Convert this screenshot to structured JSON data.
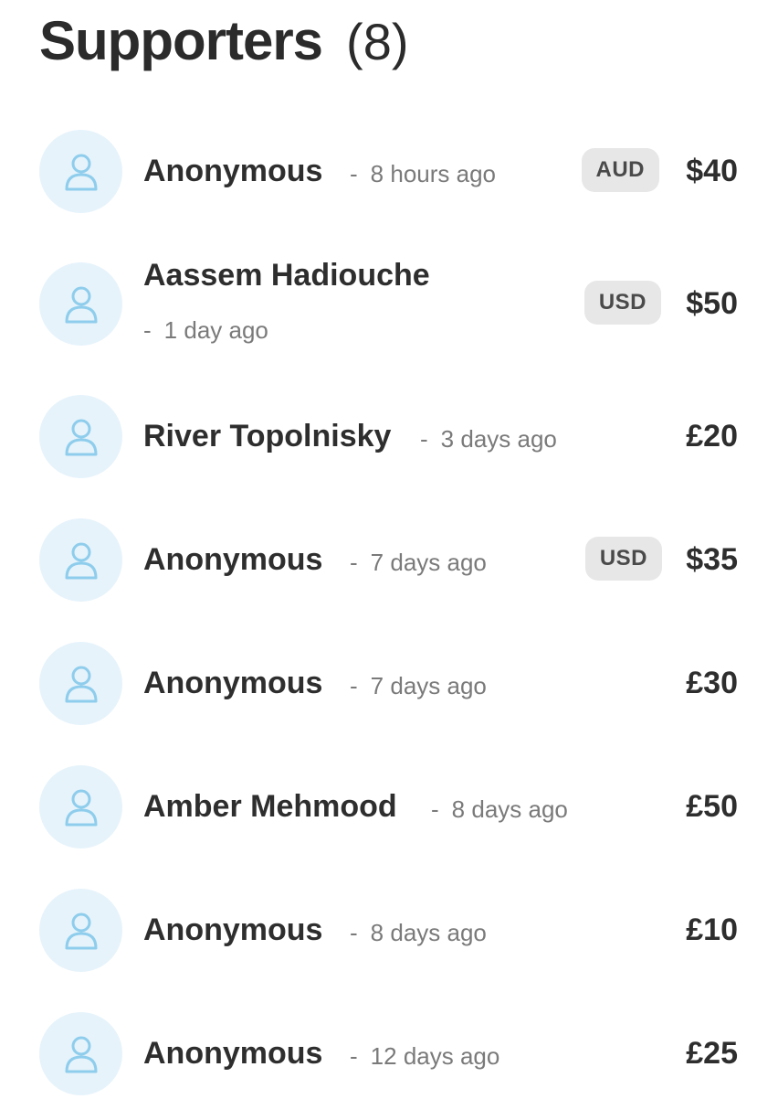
{
  "header": {
    "title": "Supporters",
    "count": "(8)"
  },
  "icons": {
    "avatar": "user-icon",
    "avatar_color": "#8fcdec",
    "avatar_bg": "#e6f3fb"
  },
  "supporters": [
    {
      "name": "Anonymous",
      "dash": "-",
      "time": "8 hours ago",
      "currency": "AUD",
      "amount": "$40"
    },
    {
      "name": "Aassem Hadiouche",
      "dash": "-",
      "time": "1 day ago",
      "currency": "USD",
      "amount": "$50"
    },
    {
      "name": "River Topolnisky",
      "dash": "-",
      "time": "3 days ago",
      "currency": "",
      "amount": "£20"
    },
    {
      "name": "Anonymous",
      "dash": "-",
      "time": "7 days ago",
      "currency": "USD",
      "amount": "$35"
    },
    {
      "name": "Anonymous",
      "dash": "-",
      "time": "7 days ago",
      "currency": "",
      "amount": "£30"
    },
    {
      "name": "Amber Mehmood",
      "dash": "-",
      "time": "8 days ago",
      "currency": "",
      "amount": "£50"
    },
    {
      "name": "Anonymous",
      "dash": "-",
      "time": "8 days ago",
      "currency": "",
      "amount": "£10"
    },
    {
      "name": "Anonymous",
      "dash": "-",
      "time": "12 days ago",
      "currency": "",
      "amount": "£25"
    }
  ]
}
